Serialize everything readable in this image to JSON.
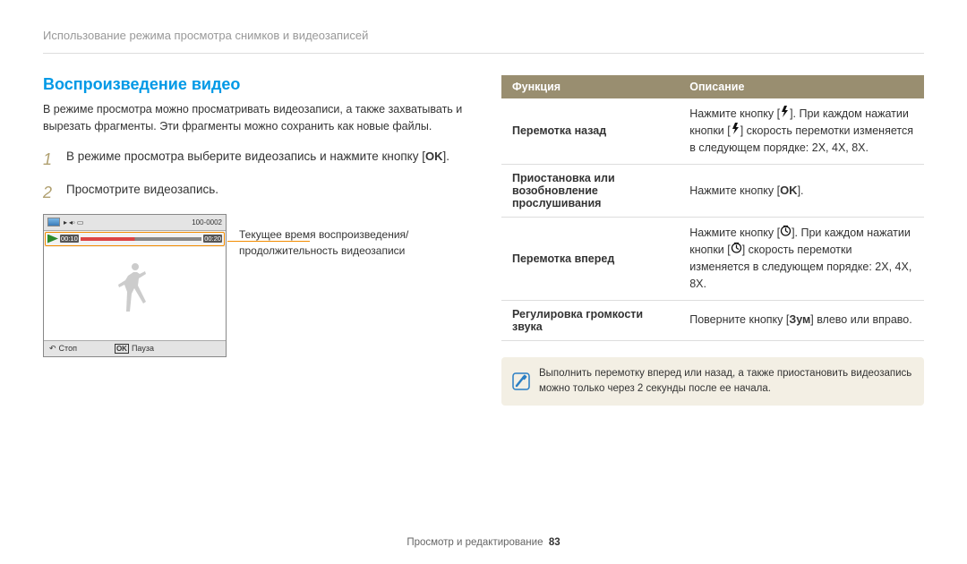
{
  "breadcrumb": "Использование режима просмотра снимков и видеозаписей",
  "section_title": "Воспроизведение видео",
  "intro": "В режиме просмотра можно просматривать видеозаписи, а также захватывать и вырезать фрагменты. Эти фрагменты можно сохранить как новые файлы.",
  "steps": [
    {
      "num": "1",
      "text_before": "В режиме просмотра выберите видеозапись и нажмите кнопку [",
      "ok": "OK",
      "text_after": "]."
    },
    {
      "num": "2",
      "text_before": "Просмотрите видеозапись.",
      "ok": "",
      "text_after": ""
    }
  ],
  "screenshot": {
    "counter": "100-0002",
    "time_current": "00:10",
    "time_total": "00:20",
    "btn_stop": "Стоп",
    "btn_pause": "Пауза",
    "btn_ok": "OK"
  },
  "callout": "Текущее время воспроизведения/продолжительность видеозаписи",
  "table": {
    "head_func": "Функция",
    "head_desc": "Описание",
    "rows": [
      {
        "func": "Перемотка назад",
        "desc_a": "Нажмите кнопку [",
        "desc_b": "]. При каждом нажатии кнопки [",
        "desc_c": "] скорость перемотки изменяется в следующем порядке: 2X, 4X, 8X.",
        "icon": "flash"
      },
      {
        "func": "Приостановка или возобновление прослушивания",
        "desc_a": "Нажмите кнопку [",
        "ok": "OK",
        "desc_c": "]."
      },
      {
        "func": "Перемотка вперед",
        "desc_a": "Нажмите кнопку [",
        "desc_b": "]. При каждом нажатии кнопки [",
        "desc_c": "] скорость перемотки изменяется в следующем порядке: 2X, 4X, 8X.",
        "icon": "timer"
      },
      {
        "func": "Регулировка громкости звука",
        "desc_plain_a": "Поверните кнопку [",
        "desc_bold": "Зум",
        "desc_plain_b": "] влево или вправо."
      }
    ]
  },
  "note": "Выполнить перемотку вперед или назад, а также приостановить видеозапись можно только через 2 секунды после ее начала.",
  "footer_text": "Просмотр и редактирование",
  "footer_page": "83"
}
